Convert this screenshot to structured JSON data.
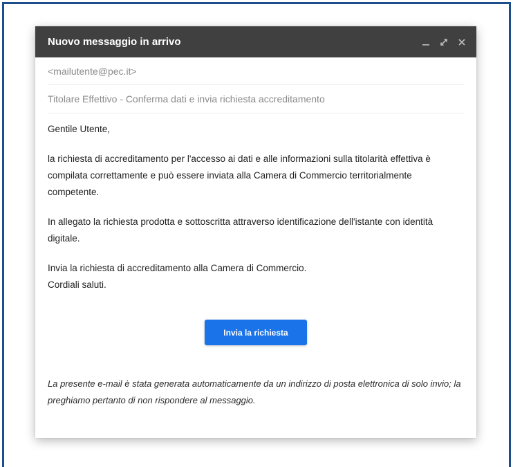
{
  "window": {
    "title": "Nuovo messaggio in arrivo"
  },
  "message": {
    "to": "<mailutente@pec.it>",
    "subject": "Titolare Effettivo - Conferma dati e invia richiesta accreditamento",
    "greeting": "Gentile Utente,",
    "paragraph_1": "la richiesta di accreditamento per l'accesso ai dati e alle informazioni sulla titolarità effettiva è compilata correttamente e può essere inviata alla Camera di Commercio territorialmente competente.",
    "paragraph_2": "In allegato la richiesta prodotta e sottoscritta attraverso identificazione dell'istante con identità digitale.",
    "paragraph_3_line_1": "Invia la richiesta di accreditamento alla Camera di Commercio.",
    "paragraph_3_line_2": "Cordiali saluti.",
    "button_label": "Invia la richiesta",
    "footer_note": "La presente e-mail è stata generata automaticamente da un indirizzo di posta elettronica di solo invio; la preghiamo pertanto di non rispondere al messaggio."
  },
  "icons": {
    "minimize": "minimize-icon",
    "expand": "expand-icon",
    "close": "close-icon"
  },
  "colors": {
    "frame_border": "#1b4f8c",
    "titlebar": "#404040",
    "button": "#1a73e8"
  }
}
